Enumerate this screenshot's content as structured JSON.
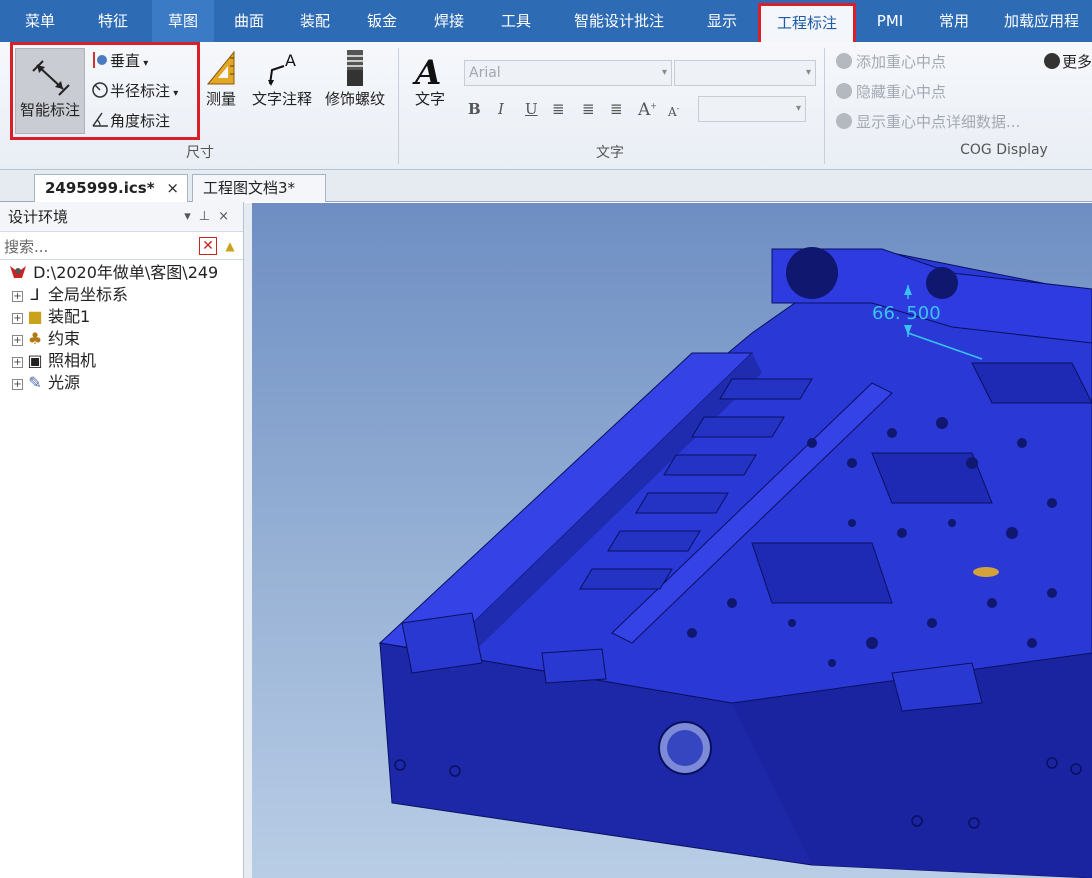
{
  "menu": {
    "tabs": [
      "菜单",
      "特征",
      "草图",
      "曲面",
      "装配",
      "钣金",
      "焊接",
      "工具",
      "智能设计批注",
      "显示",
      "工程标注",
      "PMI",
      "常用",
      "加载应用程"
    ],
    "active": "工程标注"
  },
  "ribbon": {
    "dimension": {
      "smart_label": "智能标注",
      "vertical_label": "垂直",
      "radius_label": "半径标注",
      "angle_label": "角度标注",
      "group_label": "尺寸"
    },
    "measure_label": "测量",
    "text_note_label": "文字注释",
    "thread_label": "修饰螺纹",
    "text": {
      "text_label": "文字",
      "font_value": "Arial",
      "group_label": "文字"
    },
    "cog": {
      "add": "添加重心中点",
      "hide": "隐藏重心中点",
      "show_details": "显示重心中点详细数据...",
      "group_label": "COG Display",
      "more": "更多"
    }
  },
  "documents": {
    "tabs": [
      "2495999.ics*",
      "工程图文档3*"
    ],
    "close_glyph": "×"
  },
  "panel": {
    "title": "设计环境",
    "search_placeholder": "搜索...",
    "root": "D:\\2020年做单\\客图\\249",
    "items": [
      "全局坐标系",
      "装配1",
      "约束",
      "照相机",
      "光源"
    ]
  },
  "viewport": {
    "dimension_value": "66. 500",
    "colors": {
      "part": "#2233cc",
      "dimension": "#39c3f0",
      "background": "#8fa9d0"
    }
  }
}
